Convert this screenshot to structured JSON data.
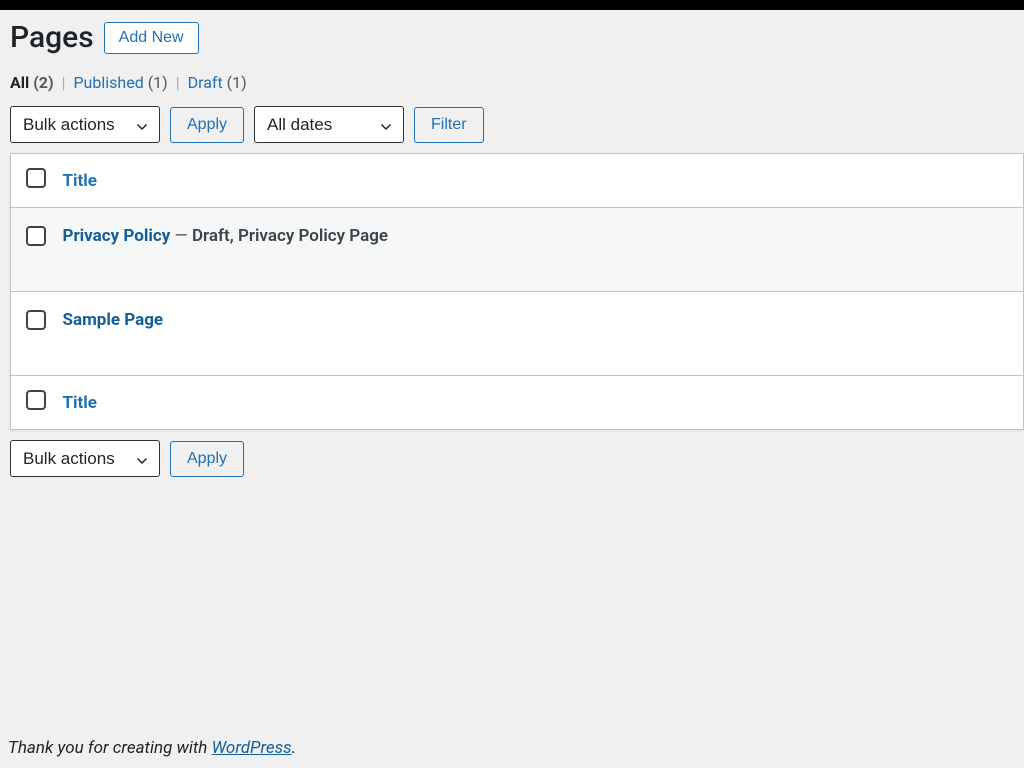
{
  "header": {
    "title": "Pages",
    "add_new": "Add New"
  },
  "filters": {
    "all_label": "All",
    "all_count": "(2)",
    "published_label": "Published",
    "published_count": "(1)",
    "draft_label": "Draft",
    "draft_count": "(1)"
  },
  "controls": {
    "bulk_actions": "Bulk actions",
    "apply": "Apply",
    "all_dates": "All dates",
    "filter": "Filter"
  },
  "table": {
    "col_title": "Title",
    "rows": [
      {
        "title": "Privacy Policy",
        "state_sep": " — ",
        "state": "Draft, Privacy Policy Page"
      },
      {
        "title": "Sample Page",
        "state_sep": "",
        "state": ""
      }
    ]
  },
  "footer": {
    "text_before": "Thank you for creating with ",
    "link_text": "WordPress",
    "text_after": "."
  }
}
